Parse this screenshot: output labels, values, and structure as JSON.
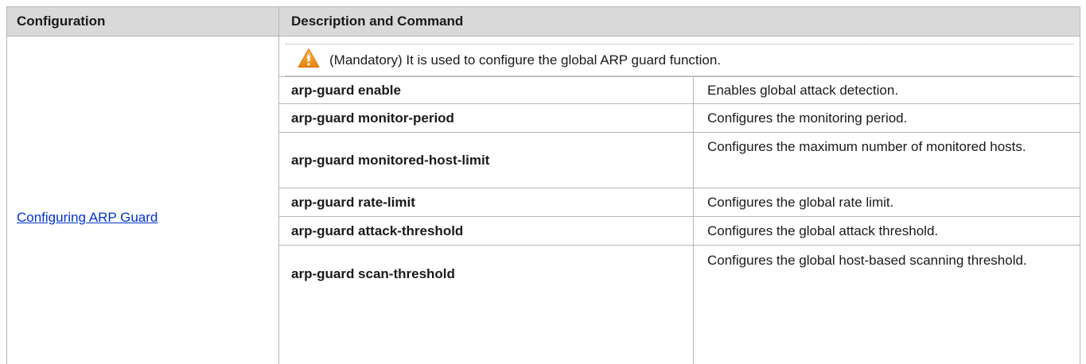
{
  "table": {
    "headers": {
      "configuration": "Configuration",
      "description": "Description and Command"
    },
    "configuration_link": "Configuring ARP Guard",
    "note": {
      "icon": "warning-icon",
      "icon_color": "#f39c12",
      "text": "(Mandatory) It is used to configure the global ARP guard function."
    },
    "commands": [
      {
        "command": "arp-guard enable",
        "description": "Enables global attack detection."
      },
      {
        "command": "arp-guard monitor-period",
        "description": "Configures the monitoring period."
      },
      {
        "command": "arp-guard monitored-host-limit",
        "description": "Configures the maximum number of monitored hosts."
      },
      {
        "command": "arp-guard rate-limit",
        "description": "Configures the global rate limit."
      },
      {
        "command": "arp-guard attack-threshold",
        "description": "Configures the global attack threshold."
      },
      {
        "command": "arp-guard scan-threshold",
        "description": "Configures the global host-based scanning threshold."
      }
    ]
  }
}
